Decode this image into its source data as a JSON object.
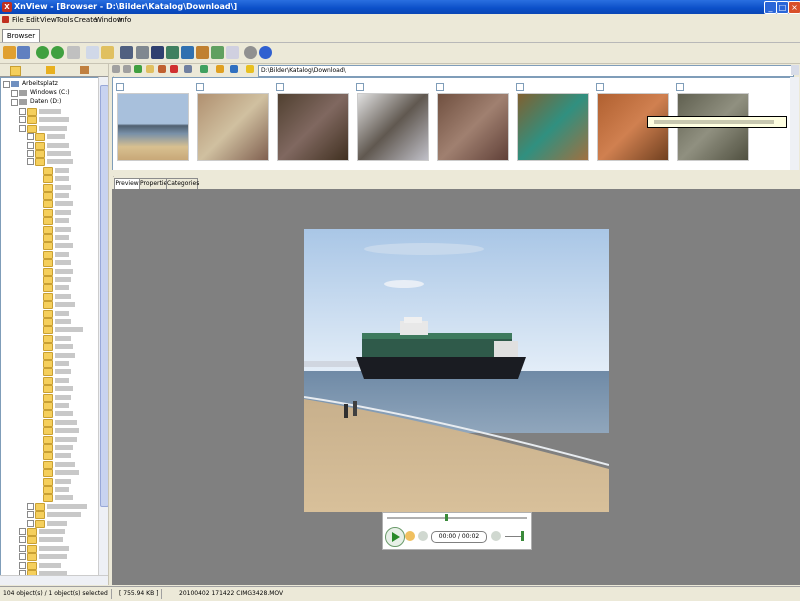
{
  "window": {
    "title": "XnView - [Browser - D:\\Bilder\\Katalog\\Download\\]",
    "controls": [
      "_",
      "□",
      "×"
    ]
  },
  "menu": [
    "File",
    "Edit",
    "View",
    "Tools",
    "Create",
    "Window",
    "Info"
  ],
  "tabs": {
    "browser": "Browser"
  },
  "path": "D:\\Bilder\\Katalog\\Download\\",
  "tree": {
    "root": "Arbeitsplatz",
    "drives": [
      "Windows (C:)",
      "Daten (D:)"
    ]
  },
  "preview_tabs": [
    "Preview",
    "Properties",
    "Categories"
  ],
  "player": {
    "time": "00:00 / 00:02"
  },
  "status": {
    "objects": "104 object(s) / 1 object(s) selected",
    "size": "[ 755.94 KB ]",
    "file": "20100402 171422 CIMG3428.MOV"
  },
  "colors": {
    "accent": "#0b4fc8",
    "preview_bg": "#808080"
  }
}
